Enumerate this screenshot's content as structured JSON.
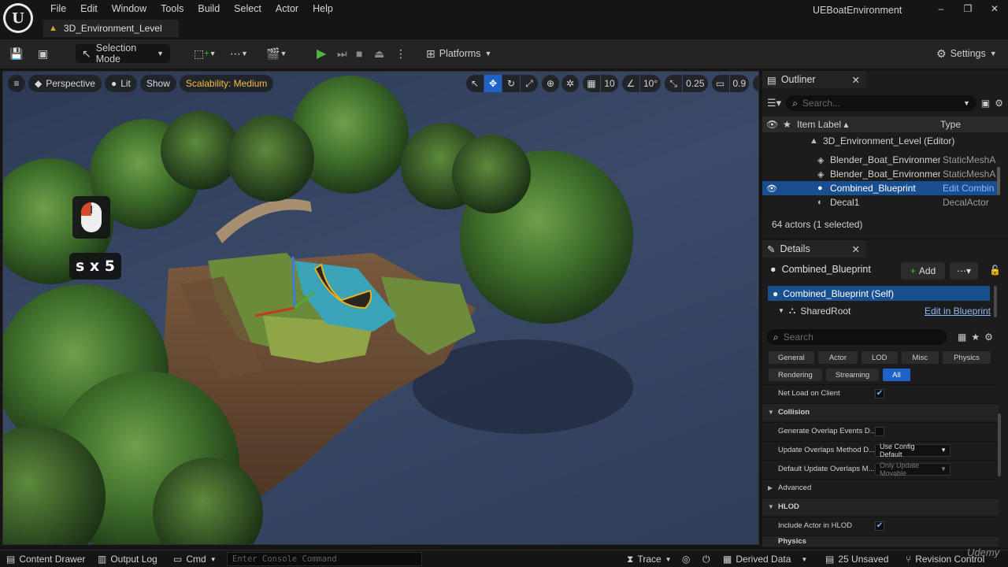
{
  "menu": [
    "File",
    "Edit",
    "Window",
    "Tools",
    "Build",
    "Select",
    "Actor",
    "Help"
  ],
  "level_tab": "3D_Environment_Level",
  "app_title": "UEBoatEnvironment",
  "window_controls": [
    "–",
    "❐",
    "✕"
  ],
  "toolbar": {
    "selection_mode": "Selection Mode",
    "platforms": "Platforms",
    "settings": "Settings"
  },
  "viewport": {
    "perspective": "Perspective",
    "lit": "Lit",
    "show": "Show",
    "scalability": "Scalability: Medium",
    "grid_snap": "10",
    "rotation_snap": "10°",
    "scale_snap": "0.25",
    "camera_speed": "0.9",
    "key_overlay": "s x 5"
  },
  "outliner": {
    "title": "Outliner",
    "search_placeholder": "Search...",
    "col_label": "Item Label ▴",
    "col_type": "Type",
    "rows": [
      {
        "label": "3D_Environment_Level (Editor)",
        "type": ""
      },
      {
        "label": "Blender_Boat_Environmen",
        "type": "StaticMeshA"
      },
      {
        "label": "Blender_Boat_Environmen",
        "type": "StaticMeshA"
      },
      {
        "label": "Combined_Blueprint",
        "type": "Edit Combin"
      },
      {
        "label": "Decal1",
        "type": "DecalActor"
      }
    ],
    "actors_count": "64 actors (1 selected)"
  },
  "details": {
    "title": "Details",
    "object_name": "Combined_Blueprint",
    "add_label": "Add",
    "self_label": "Combined_Blueprint (Self)",
    "shared_root": "SharedRoot",
    "edit_in_blueprint": "Edit in Blueprint",
    "search_placeholder": "Search",
    "filter_tabs_row1": [
      "General",
      "Actor",
      "LOD",
      "Misc",
      "Physics"
    ],
    "filter_tabs_row2": [
      "Rendering",
      "Streaming",
      "All"
    ],
    "props": {
      "net_load": "Net Load on Client",
      "collision": "Collision",
      "gen_overlap": "Generate Overlap Events D...",
      "update_overlaps": "Update Overlaps Method D...",
      "update_overlaps_value": "Use Config Default",
      "default_update": "Default Update Overlaps M...",
      "default_update_value": "Only Update Movable",
      "advanced": "Advanced",
      "hlod": "HLOD",
      "include_hlod": "Include Actor in HLOD",
      "physics": "Physics"
    }
  },
  "statusbar": {
    "content_drawer": "Content Drawer",
    "output_log": "Output Log",
    "cmd": "Cmd",
    "console_placeholder": "Enter Console Command",
    "trace": "Trace",
    "derived_data": "Derived Data",
    "unsaved": "25 Unsaved",
    "revision_control": "Revision Control"
  },
  "watermark": "Udemy"
}
